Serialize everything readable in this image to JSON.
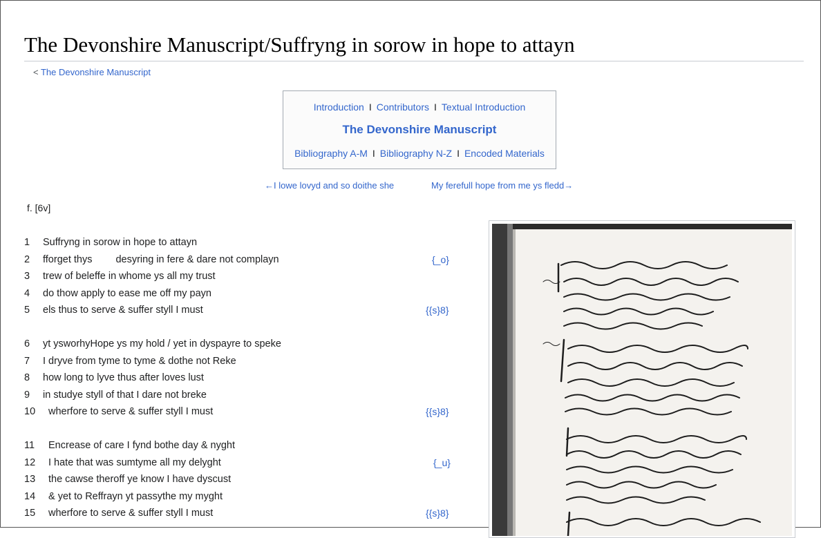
{
  "page": {
    "title": "The Devonshire Manuscript/Suffryng in sorow in hope to attayn",
    "back_prefix": "< ",
    "back_link": "The Devonshire Manuscript"
  },
  "navbox": {
    "row1": [
      "Introduction",
      "Contributors",
      "Textual Introduction"
    ],
    "main": "The Devonshire Manuscript",
    "row3": [
      "Bibliography A-M",
      "Bibliography N-Z",
      "Encoded Materials"
    ],
    "separator": "I"
  },
  "nav": {
    "prev": "←I lowe lovyd and so doithe she",
    "next": "My ferefull hope from me ys fledd→"
  },
  "folio": "f. [6v]",
  "poem": [
    {
      "num": "1",
      "text": "Suffryng in sorow in hope to attayn",
      "marker": ""
    },
    {
      "num": "2",
      "text_a": "fforget thys",
      "text_b": "desyring in fere & dare not complayn",
      "marker": "{_o}"
    },
    {
      "num": "3",
      "text": "trew of beleffe in whome ys all my trust",
      "marker": ""
    },
    {
      "num": "4",
      "text": "do thow apply to ease me off my payn",
      "marker": ""
    },
    {
      "num": "5",
      "text": "els thus to serve & suffer styll I must",
      "marker": "{{s}8}"
    },
    {
      "num": "6",
      "text": "yt ysworhyHope ys my hold / yet in dyspayre to speke",
      "marker": ""
    },
    {
      "num": "7",
      "text": "I dryve from tyme to tyme & dothe not Reke",
      "marker": ""
    },
    {
      "num": "8",
      "text": "how long to lyve thus after loves lust",
      "marker": ""
    },
    {
      "num": "9",
      "text": "in studye styll of that I dare not breke",
      "marker": ""
    },
    {
      "num": "10",
      "text": "wherfore to serve & suffer styll I must",
      "marker": "{{s}8}"
    },
    {
      "num": "11",
      "text": "Encrease of care I fynd bothe day & nyght",
      "marker": ""
    },
    {
      "num": "12",
      "text": "I hate that was sumtyme all my delyght",
      "marker": "{_u}"
    },
    {
      "num": "13",
      "text": "the cawse theroff ye know I have dyscust",
      "marker": ""
    },
    {
      "num": "14",
      "text": "& yet to Reffrayn yt passythe my myght",
      "marker": ""
    },
    {
      "num": "15",
      "text": "wherfore to serve & suffer styll I must",
      "marker": "{{s}8}"
    }
  ]
}
